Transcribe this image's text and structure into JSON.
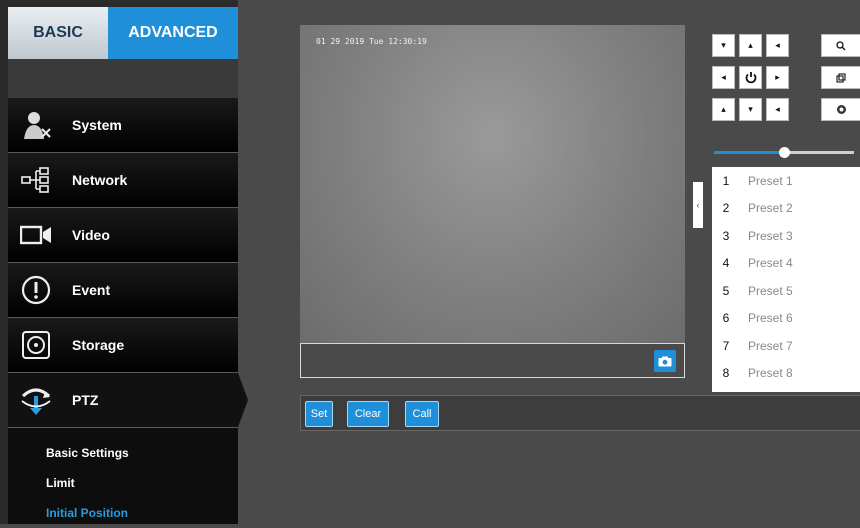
{
  "tabs": {
    "basic": "BASIC",
    "advanced": "ADVANCED"
  },
  "menu": [
    {
      "label": "System",
      "icon": "system-user-icon"
    },
    {
      "label": "Network",
      "icon": "network-icon"
    },
    {
      "label": "Video",
      "icon": "video-camera-icon"
    },
    {
      "label": "Event",
      "icon": "alert-icon"
    },
    {
      "label": "Storage",
      "icon": "storage-disk-icon"
    },
    {
      "label": "PTZ",
      "icon": "ptz-arrows-icon"
    }
  ],
  "submenu": [
    "Basic Settings",
    "Limit",
    "Initial Position"
  ],
  "video": {
    "timestamp": "01 29 2019 Tue 12:30:19"
  },
  "buttons": {
    "set": "Set",
    "clear": "Clear",
    "call": "Call"
  },
  "presets": [
    {
      "num": "1",
      "name": "Preset 1"
    },
    {
      "num": "2",
      "name": "Preset 2"
    },
    {
      "num": "3",
      "name": "Preset 3"
    },
    {
      "num": "4",
      "name": "Preset 4"
    },
    {
      "num": "5",
      "name": "Preset 5"
    },
    {
      "num": "6",
      "name": "Preset 6"
    },
    {
      "num": "7",
      "name": "Preset 7"
    },
    {
      "num": "8",
      "name": "Preset 8"
    }
  ],
  "speed_slider": {
    "value_fraction": 0.5
  },
  "colors": {
    "accent": "#1f8fd9",
    "sidebar": "#000000",
    "background": "#4a4a4a"
  }
}
